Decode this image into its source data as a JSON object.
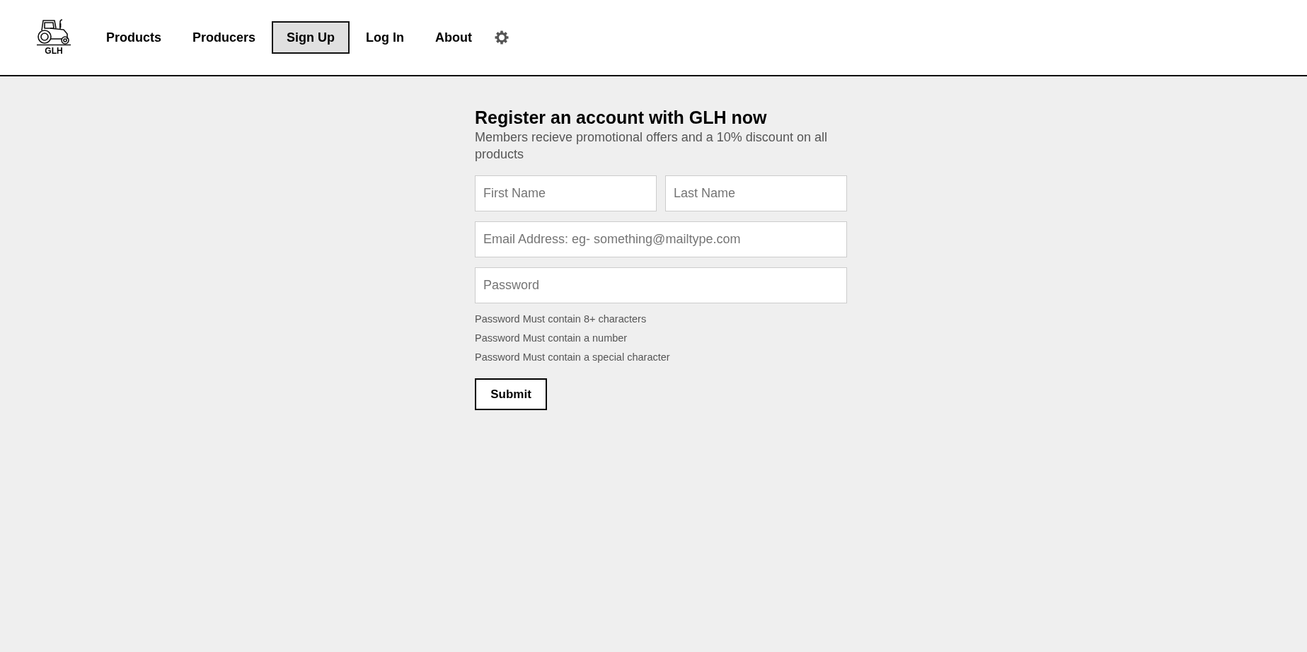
{
  "header": {
    "logo_text": "GLH",
    "nav": [
      {
        "label": "Products",
        "selected": false
      },
      {
        "label": "Producers",
        "selected": false
      },
      {
        "label": "Sign Up",
        "selected": true
      },
      {
        "label": "Log In",
        "selected": false
      },
      {
        "label": "About",
        "selected": false
      }
    ]
  },
  "form": {
    "title": "Register an account with GLH now",
    "subtitle": "Members recieve promotional offers and a 10% discount on all products",
    "field_rows": [
      {
        "fields": [
          {
            "placeholder": "First Name"
          },
          {
            "placeholder": "Last Name"
          }
        ]
      },
      {
        "fields": [
          {
            "placeholder": "Email Address: eg- something@mailtype.com"
          }
        ]
      },
      {
        "fields": [
          {
            "placeholder": "Password"
          }
        ]
      }
    ],
    "hints": [
      "Password Must contain 8+ characters",
      "Password Must contain a number",
      "Password Must contain a special character"
    ],
    "submit": "Submit"
  }
}
